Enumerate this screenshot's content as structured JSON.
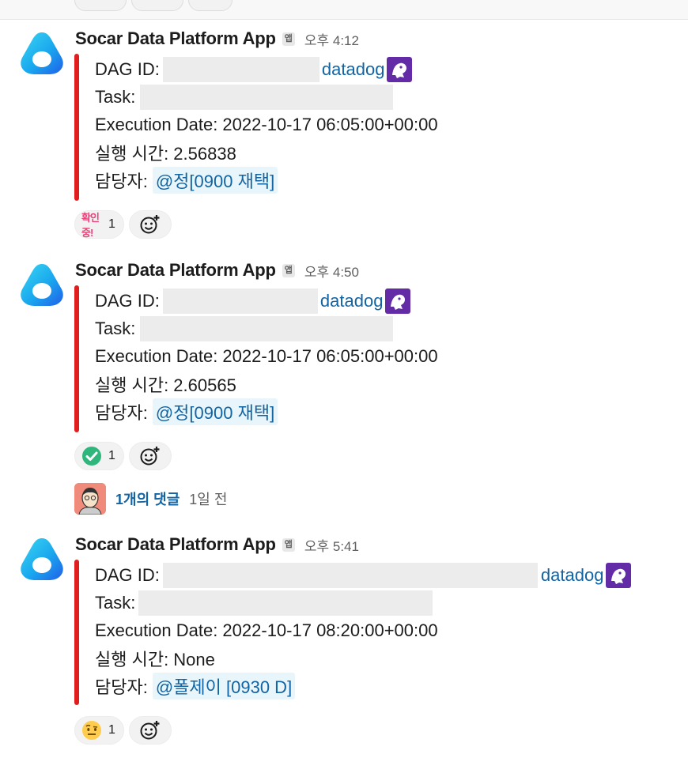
{
  "colors": {
    "attachment_bar": "#e01e1e",
    "link": "#1264a3",
    "mention_bg": "#e8f5fa",
    "redaction": "#ececec"
  },
  "messages": [
    {
      "app_name": "Socar Data Platform App",
      "badge": "앱",
      "time": "오후 4:12",
      "dag_label": "DAG ID:",
      "dag_link": "datadog",
      "task_label": "Task:",
      "execution_date": "Execution Date: 2022-10-17 06:05:00+00:00",
      "run_time": "실행 시간: 2.56838",
      "owner_label": "담당자:",
      "owner_mention": "@정[0900 재택]",
      "reactions": [
        {
          "emoji": "확인중!",
          "icon": "checking-text-emoji",
          "count": "1"
        }
      ]
    },
    {
      "app_name": "Socar Data Platform App",
      "badge": "앱",
      "time": "오후 4:50",
      "dag_label": "DAG ID:",
      "dag_link": "datadog",
      "task_label": "Task:",
      "execution_date": "Execution Date: 2022-10-17 06:05:00+00:00",
      "run_time": "실행 시간: 2.60565",
      "owner_label": "담당자:",
      "owner_mention": "@정[0900 재택]",
      "reactions": [
        {
          "icon": "green-check-emoji",
          "count": "1"
        }
      ],
      "thread": {
        "replies": "1개의 댓글",
        "time": "1일 전"
      }
    },
    {
      "app_name": "Socar Data Platform App",
      "badge": "앱",
      "time": "오후 5:41",
      "dag_label": "DAG ID:",
      "dag_link": "datadog",
      "task_label": "Task:",
      "execution_date": "Execution Date: 2022-10-17 08:20:00+00:00",
      "run_time": "실행 시간: None",
      "owner_label": "담당자:",
      "owner_mention": "@폴제이 [0930 D]",
      "reactions": [
        {
          "icon": "raised-eyebrow-face-emoji",
          "count": "1"
        }
      ]
    }
  ]
}
